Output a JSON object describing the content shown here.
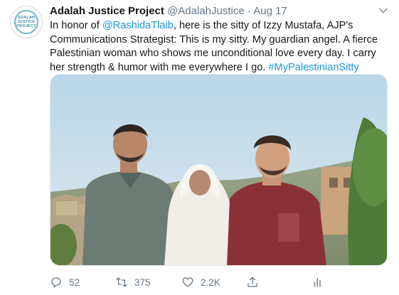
{
  "tweet": {
    "avatar_text": [
      "ADALAH",
      "JUSTICE",
      "PROJECT"
    ],
    "name": "Adalah Justice Project",
    "handle": "@AdalahJustice",
    "separator": "·",
    "date": "Aug 17",
    "text": {
      "l1_a": "In honor of ",
      "l1_mention": "@RashidaTlaib",
      "l1_b": ", here is the sitty of Izzy Mustafa, AJP's",
      "l2": "Communications Strategist: This is my sitty. My guardian angel. A fierce",
      "l3": "Palestinian woman who shows me unconditional love every day. I carry",
      "l4_a": "her strength & humor with me everywhere I go. ",
      "l4_hashtag": "#MyPalestinianSitty"
    },
    "actions": {
      "replies": "52",
      "retweets": "375",
      "likes": "2.2K"
    }
  },
  "colors": {
    "link": "#1b95e0",
    "secondary_text": "#657786",
    "primary_text": "#14171a"
  },
  "icons": [
    "chevron-down-icon",
    "reply-icon",
    "retweet-icon",
    "like-icon",
    "share-icon",
    "analytics-icon"
  ]
}
